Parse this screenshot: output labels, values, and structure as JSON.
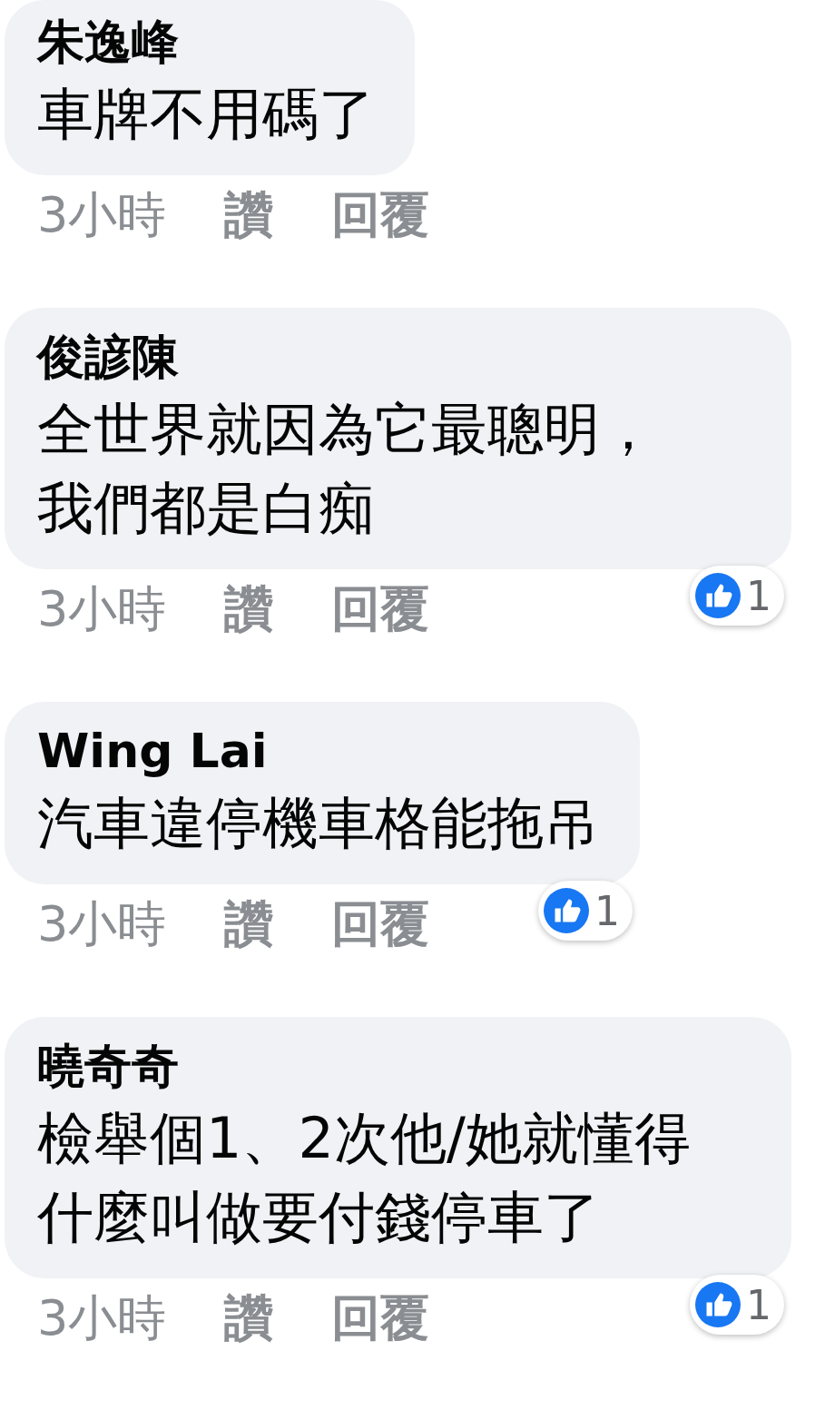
{
  "comments": [
    {
      "name": "朱逸峰",
      "lines": [
        "車牌不用碼了"
      ],
      "time": "3小時",
      "like": "讚",
      "reply": "回覆"
    },
    {
      "name": "俊諺陳",
      "lines": [
        "全世界就因為它最聰明，",
        "我們都是白痴"
      ],
      "time": "3小時",
      "like": "讚",
      "reply": "回覆",
      "reaction_count": "1"
    },
    {
      "name": "Wing Lai",
      "lines": [
        "汽車違停機車格能拖吊"
      ],
      "time": "3小時",
      "like": "讚",
      "reply": "回覆",
      "reaction_count": "1"
    },
    {
      "name": "曉奇奇",
      "lines": [
        "檢舉個1、2次他/她就懂得",
        "什麼叫做要付錢停車了"
      ],
      "time": "3小時",
      "like": "讚",
      "reply": "回覆",
      "reaction_count": "1"
    }
  ]
}
